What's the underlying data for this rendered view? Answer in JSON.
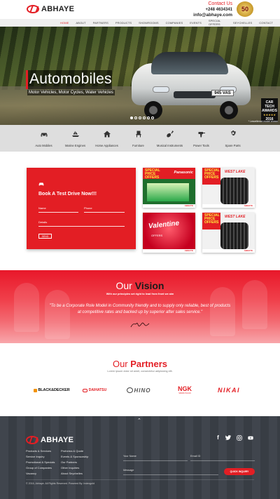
{
  "header": {
    "logo_text": "ABHAYE",
    "contact_title": "Contact Us",
    "phone": "+248 4634341",
    "email": "info@abhaye.com",
    "anniversary": "50"
  },
  "nav": [
    "HOME",
    "ABOUT",
    "PARTNERS",
    "PRODUCTS",
    "SHOWROOMS",
    "COMPANIES",
    "EVENTS",
    "SPECIAL OFFERS",
    "SEYCHELLES",
    "CONTACT"
  ],
  "hero": {
    "title": "Automobiles",
    "subtitle": "Motor Vehicles, Motor Cycles, Water Vehicles",
    "plate": "945 VAS",
    "award_title": "CAR TECH AWARDS",
    "award_year": "2016",
    "caption": "* Lexcellence model shown",
    "dots": 6
  },
  "categories": [
    {
      "label": "Auto Mobiles",
      "icon": "car-icon"
    },
    {
      "label": "Marine Engines",
      "icon": "boat-icon"
    },
    {
      "label": "Home Appliances",
      "icon": "home-icon"
    },
    {
      "label": "Furniture",
      "icon": "chair-icon"
    },
    {
      "label": "Musical Instruments",
      "icon": "guitar-icon"
    },
    {
      "label": "Power Tools",
      "icon": "drill-icon"
    },
    {
      "label": "Spare Parts",
      "icon": "gear-icon"
    }
  ],
  "test_drive": {
    "title": "Book A Test Drive Now!!!",
    "name_label": "Name",
    "phone_label": "Phone",
    "details_label": "Details",
    "send_label": "SEND"
  },
  "promos": [
    {
      "head": "SPECIAL PRICE OFFERS",
      "brand": "Panasonic",
      "foot": "ABHAYE"
    },
    {
      "head": "SPECIAL PRICE OFFERS",
      "brand": "WEST LAKE",
      "foot": "ABHAYE"
    },
    {
      "head": "",
      "brand": "Valentine",
      "sub": "OFFERS",
      "foot": "ABHAYE"
    },
    {
      "head": "SPECIAL PRICE OFFERS",
      "brand": "WEST LAKE",
      "foot": "ABHAYE"
    }
  ],
  "vision": {
    "title_a": "Our ",
    "title_b": "Vision",
    "subtitle": "With our principles set right to lead from front we aim",
    "quote": "\"To be a Corporate Role Model in Community friendly and to supply only reliable, best of products at competitive rates and backed up by superior after sales service.\""
  },
  "partners": {
    "title_a": "Our ",
    "title_b": "Partners",
    "subtitle": "Lorem ipsum dolor sit amet, consectetur adipisicing elit.",
    "logos": [
      "BLACK&DECKER",
      "DAIHATSU",
      "HINO",
      "NGK",
      "NIKAI"
    ],
    "ngk_sub": "SPARK PLUGS"
  },
  "footer": {
    "logo_text": "ABHAYE",
    "col1": [
      "Products & Services",
      "Service Inquiry",
      "Promotional & Specials",
      "Group of Companies",
      "Vacancy"
    ],
    "col2": [
      "Proforma & Quote",
      "Events & Sponsorship",
      "Our Partners",
      "Other Inquiries",
      "About Seychelles"
    ],
    "your_name": "Your Name",
    "email_id": "Email ID",
    "message": "Message",
    "quick_inquiry": "QUICK INQUIRY",
    "copyright": "© 2016, Abhaye. All Rights Reserved. Powered By: Indexgold"
  },
  "colors": {
    "brand_red": "#e31e24",
    "footer_bg": "#3a3f47"
  }
}
